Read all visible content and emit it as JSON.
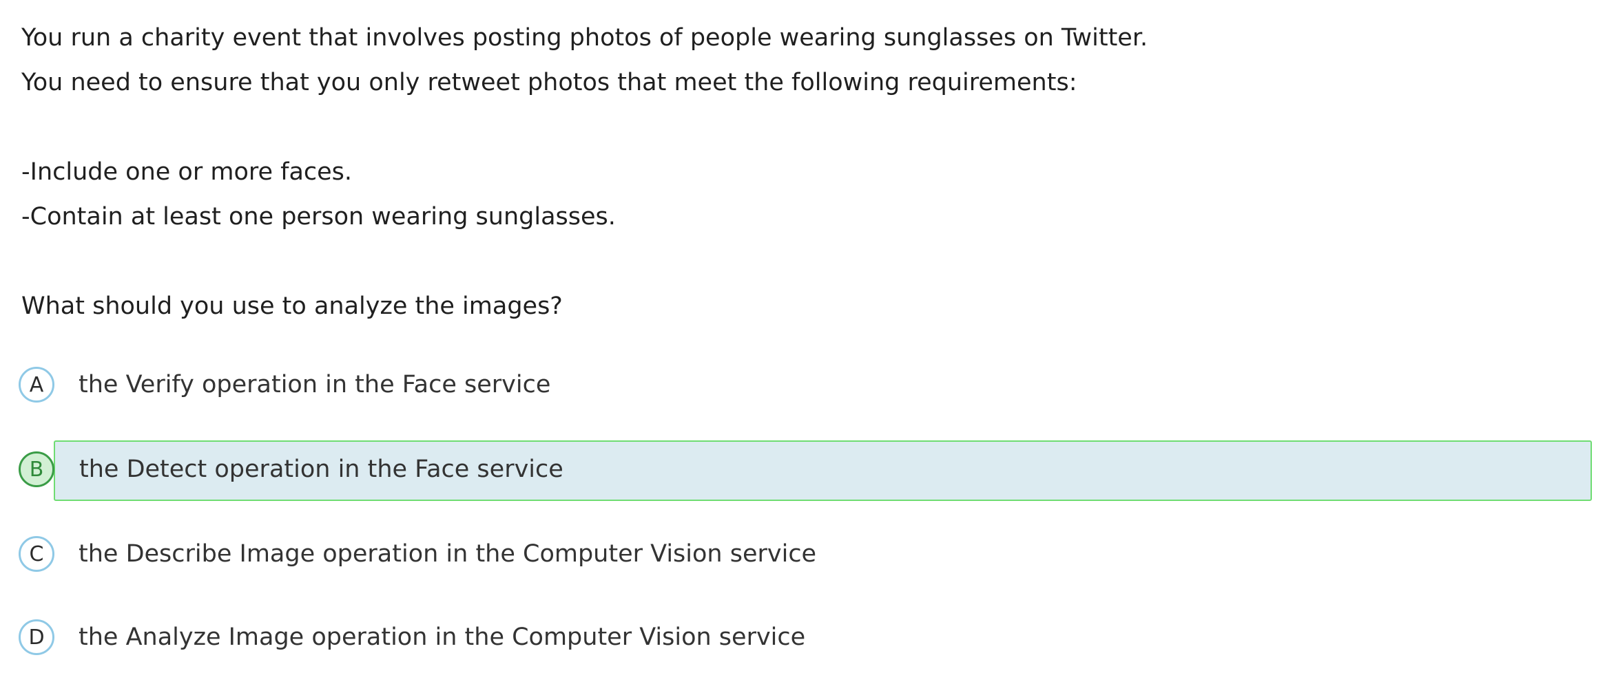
{
  "question": {
    "line1": "You run a charity event that involves posting photos of people wearing sunglasses on Twitter.",
    "line2": "You need to ensure that you only retweet photos that meet the following requirements:",
    "req1": "-Include one or more faces.",
    "req2": "-Contain at least one person wearing sunglasses.",
    "prompt": "What should you use to analyze the images?"
  },
  "options": [
    {
      "letter": "A",
      "text": "the Verify operation in the Face service",
      "selected": false
    },
    {
      "letter": "B",
      "text": "the Detect operation in the Face service",
      "selected": true
    },
    {
      "letter": "C",
      "text": "the Describe Image operation in the Computer Vision service",
      "selected": false
    },
    {
      "letter": "D",
      "text": "the Analyze Image operation in the Computer Vision service",
      "selected": false
    }
  ],
  "colors": {
    "badge_border": "#8fc9e6",
    "selected_fill": "#dcebf1",
    "selected_border": "#6fdc72",
    "selected_badge": "#3a9c46"
  }
}
